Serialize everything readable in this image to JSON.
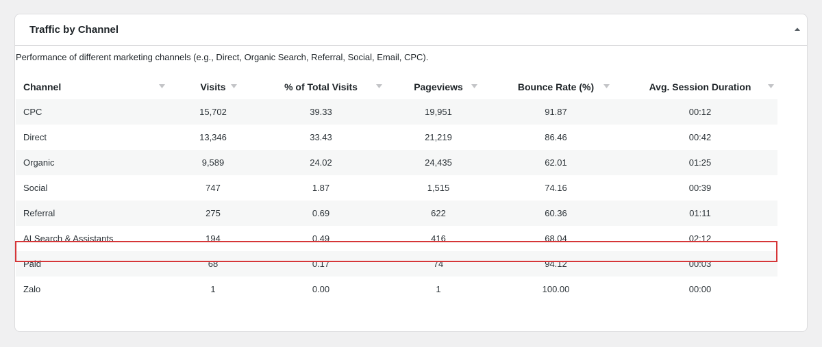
{
  "panel": {
    "title": "Traffic by Channel",
    "description": "Performance of different marketing channels (e.g., Direct, Organic Search, Referral, Social, Email, CPC)."
  },
  "table": {
    "columns": [
      "Channel",
      "Visits",
      "% of Total Visits",
      "Pageviews",
      "Bounce Rate (%)",
      "Avg. Session Duration"
    ],
    "rows": [
      [
        "CPC",
        "15,702",
        "39.33",
        "19,951",
        "91.87",
        "00:12"
      ],
      [
        "Direct",
        "13,346",
        "33.43",
        "21,219",
        "86.46",
        "00:42"
      ],
      [
        "Organic",
        "9,589",
        "24.02",
        "24,435",
        "62.01",
        "01:25"
      ],
      [
        "Social",
        "747",
        "1.87",
        "1,515",
        "74.16",
        "00:39"
      ],
      [
        "Referral",
        "275",
        "0.69",
        "622",
        "60.36",
        "01:11"
      ],
      [
        "AI Search & Assistants",
        "194",
        "0.49",
        "416",
        "68.04",
        "02:12"
      ],
      [
        "Paid",
        "68",
        "0.17",
        "74",
        "94.12",
        "00:03"
      ],
      [
        "Zalo",
        "1",
        "0.00",
        "1",
        "100.00",
        "00:00"
      ]
    ],
    "highlighted_row": "AI Search & Assistants"
  },
  "icons": {
    "collapse": "caret-up-icon",
    "sort": "sort-down-icon"
  },
  "colors": {
    "highlight_border": "#d63638",
    "stripe": "#f6f7f7",
    "sort_icon": "#c3c4c7"
  }
}
